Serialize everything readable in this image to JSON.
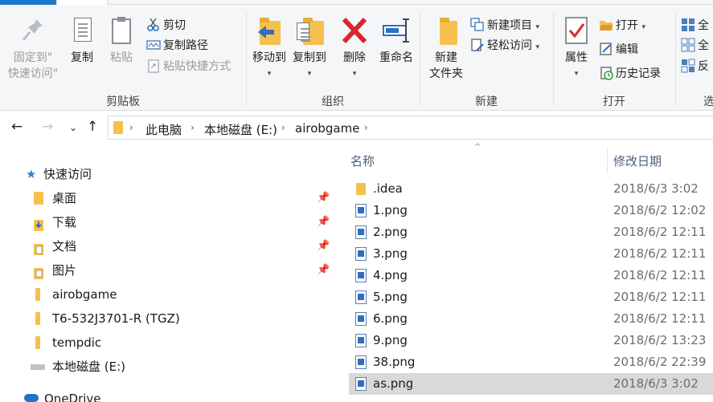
{
  "ribbon": {
    "clipboard": {
      "label": "剪贴板",
      "pin_label": "固定到\"\n快速访问\"",
      "pin_line1": "固定到\"",
      "pin_line2": "快速访问\"",
      "copy": "复制",
      "paste": "粘贴",
      "cut": "剪切",
      "copy_path": "复制路径",
      "paste_shortcut": "粘贴快捷方式"
    },
    "organize": {
      "label": "组织",
      "move_to": "移动到",
      "copy_to": "复制到",
      "delete": "删除",
      "rename": "重命名"
    },
    "new": {
      "label": "新建",
      "new_folder_line1": "新建",
      "new_folder_line2": "文件夹",
      "new_item": "新建项目",
      "easy_access": "轻松访问"
    },
    "open": {
      "label": "打开",
      "properties": "属性",
      "open": "打开",
      "edit": "编辑",
      "history": "历史记录"
    },
    "select": {
      "label": "选",
      "all": "全",
      "none": "全",
      "invert": "反"
    }
  },
  "address": {
    "crumbs": [
      "此电脑",
      "本地磁盘 (E:)",
      "airobgame"
    ]
  },
  "navpane": {
    "items": [
      {
        "label": "快速访问",
        "icon": "star-icon"
      },
      {
        "label": "桌面",
        "icon": "folder-icon",
        "pinned": true
      },
      {
        "label": "下载",
        "icon": "download-icon",
        "pinned": true
      },
      {
        "label": "文档",
        "icon": "documents-icon",
        "pinned": true
      },
      {
        "label": "图片",
        "icon": "pictures-icon",
        "pinned": true
      },
      {
        "label": "airobgame",
        "icon": "folder-icon"
      },
      {
        "label": "T6-532J3701-R (TGZ)",
        "icon": "folder-icon"
      },
      {
        "label": "tempdic",
        "icon": "folder-icon"
      },
      {
        "label": "本地磁盘 (E:)",
        "icon": "drive-icon"
      },
      {
        "label": "OneDrive",
        "icon": "cloud-icon"
      }
    ]
  },
  "filelist": {
    "col_name": "名称",
    "col_date": "修改日期",
    "rows": [
      {
        "name": ".idea",
        "date": "2018/6/3 3:02",
        "type": "folder"
      },
      {
        "name": "1.png",
        "date": "2018/6/2 12:02",
        "type": "png"
      },
      {
        "name": "2.png",
        "date": "2018/6/2 12:11",
        "type": "png"
      },
      {
        "name": "3.png",
        "date": "2018/6/2 12:11",
        "type": "png"
      },
      {
        "name": "4.png",
        "date": "2018/6/2 12:11",
        "type": "png"
      },
      {
        "name": "5.png",
        "date": "2018/6/2 12:11",
        "type": "png"
      },
      {
        "name": "6.png",
        "date": "2018/6/2 12:11",
        "type": "png"
      },
      {
        "name": "9.png",
        "date": "2018/6/2 13:23",
        "type": "png"
      },
      {
        "name": "38.png",
        "date": "2018/6/2 22:39",
        "type": "png"
      },
      {
        "name": "as.png",
        "date": "2018/6/3 3:02",
        "type": "png",
        "selected": true
      }
    ]
  }
}
